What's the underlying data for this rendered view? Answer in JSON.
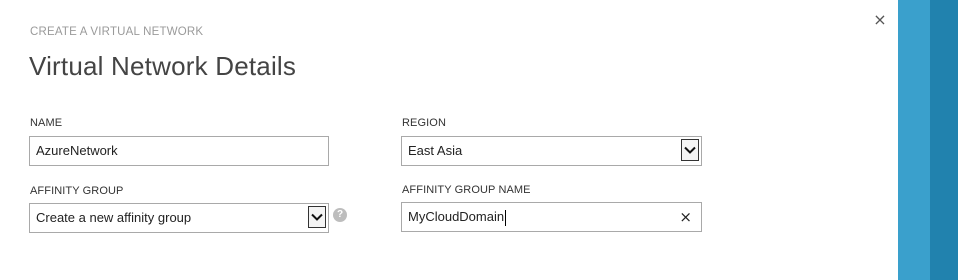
{
  "colors": {
    "strip_light": "#3aa0cc",
    "strip_dark": "#2182ae"
  },
  "header": {
    "subtitle": "CREATE A VIRTUAL NETWORK",
    "title": "Virtual Network Details",
    "close_icon": "close-icon",
    "close_glyph": "×"
  },
  "form": {
    "name": {
      "label": "NAME",
      "value": "AzureNetwork"
    },
    "region": {
      "label": "REGION",
      "value": "East Asia",
      "icon": "chevron-down-icon"
    },
    "affinity_group": {
      "label": "AFFINITY GROUP",
      "value": "Create a new affinity group",
      "icon": "chevron-down-icon",
      "help_icon": "help-icon",
      "help_glyph": "?"
    },
    "affinity_group_name": {
      "label": "AFFINITY GROUP NAME",
      "value": "MyCloudDomain",
      "clear_icon": "clear-icon",
      "clear_glyph": "×"
    }
  }
}
